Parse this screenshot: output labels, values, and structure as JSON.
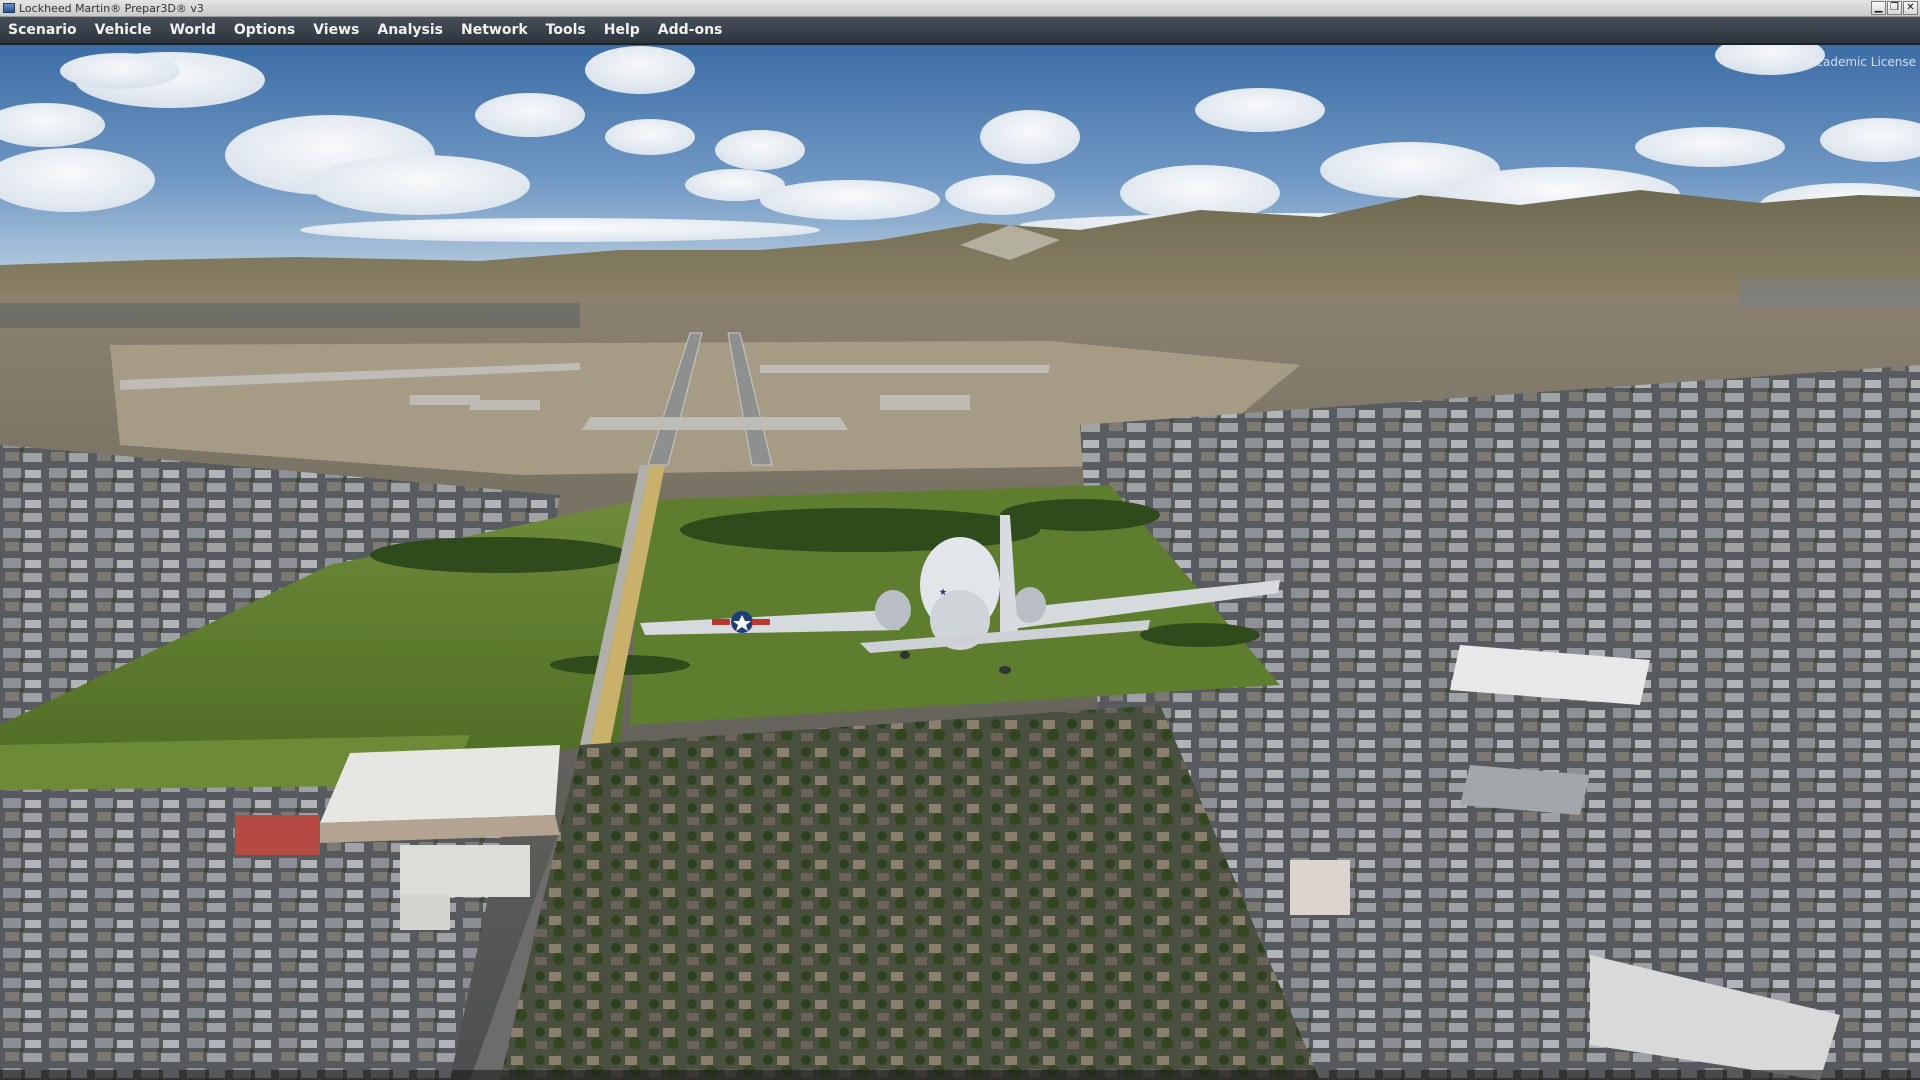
{
  "window": {
    "title": "Lockheed Martin® Prepar3D® v3",
    "controls": {
      "minimize_glyph": "▁",
      "restore_glyph": "❐",
      "close_glyph": "✕"
    }
  },
  "menu": {
    "items": [
      {
        "label": "Scenario"
      },
      {
        "label": "Vehicle"
      },
      {
        "label": "World"
      },
      {
        "label": "Options"
      },
      {
        "label": "Views"
      },
      {
        "label": "Analysis"
      },
      {
        "label": "Network"
      },
      {
        "label": "Tools"
      },
      {
        "label": "Help"
      },
      {
        "label": "Add-ons"
      }
    ]
  },
  "viewport": {
    "watermark": "Academic License",
    "icons": {
      "aircraft": "aircraft-icon",
      "app": "prepar3d-app-icon"
    },
    "colors": {
      "sky_top": "#3f6fa8",
      "sky_horizon": "#b9cde0",
      "hills": "#8a7c5e",
      "airfield": "#a69c86",
      "city": "#5d6066",
      "grass": "#5d7a2c",
      "aircraft": "#dfe3e8"
    }
  }
}
